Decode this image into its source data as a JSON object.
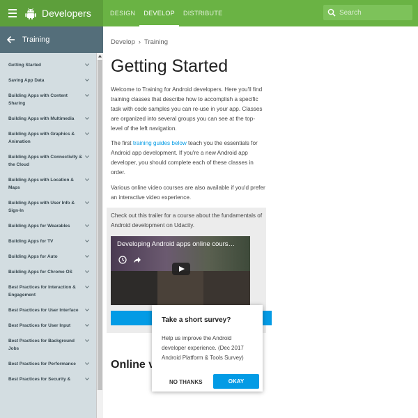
{
  "header": {
    "brand": "Developers",
    "nav": [
      "DESIGN",
      "DEVELOP",
      "DISTRIBUTE"
    ],
    "active_nav": "DEVELOP",
    "search_placeholder": "Search",
    "search_value": ""
  },
  "sidebar": {
    "title": "Training",
    "items": [
      "Getting Started",
      "Saving App Data",
      "Building Apps with Content Sharing",
      "Building Apps with Multimedia",
      "Building Apps with Graphics & Animation",
      "Building Apps with Connectivity & the Cloud",
      "Building Apps with Location & Maps",
      "Building Apps with User Info & Sign-In",
      "Building Apps for Wearables",
      "Building Apps for TV",
      "Building Apps for Auto",
      "Building Apps for Chrome OS",
      "Best Practices for Interaction & Engagement",
      "Best Practices for User Interface",
      "Best Practices for User Input",
      "Best Practices for Background Jobs",
      "Best Practices for Performance",
      "Best Practices for Security &"
    ]
  },
  "breadcrumb": [
    "Develop",
    "Training"
  ],
  "breadcrumb_separator": "›",
  "main": {
    "title": "Getting Started",
    "intro": "Welcome to Training for Android developers. Here you'll find training classes that describe how to accomplish a specific task with code samples you can re-use in your app. Classes are organized into several groups you can see at the top-level of the left navigation.",
    "para2_before": "The first ",
    "para2_link": "training guides below",
    "para2_after": " teach you the essentials for Android app development. If you're a new Android app developer, you should complete each of these classes in order.",
    "para3": "Various online video courses are also available if you'd prefer an interactive video experience.",
    "trailer_text": "Check out this trailer for a course about the fundamentals of Android development on Udacity.",
    "video_title": "Developing Android apps online cours…",
    "section_title": "Online v"
  },
  "survey": {
    "title": "Take a short survey?",
    "body": "Help us improve the Android developer experience. (Dec 2017 Android Platform & Tools Survey)",
    "no_label": "NO THANKS",
    "ok_label": "OKAY"
  },
  "colors": {
    "header_green": "#6ab344",
    "header_dark_green": "#5d9f3b",
    "sidebar_bg": "#d3dde1",
    "sidebar_header": "#546e7a",
    "accent_blue": "#039be5"
  }
}
